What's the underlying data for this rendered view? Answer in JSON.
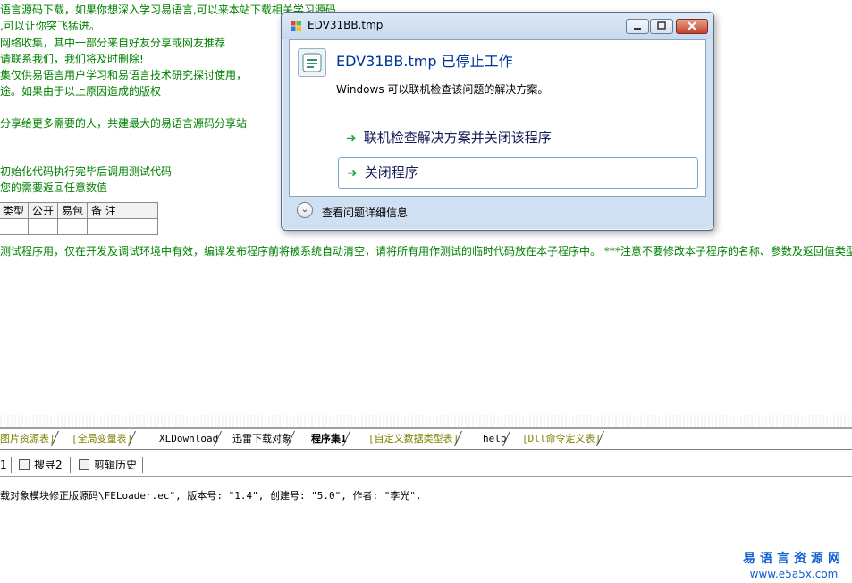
{
  "code_comments": [
    "语言源码下载，如果你想深入学习易语言,可以来本站下载相关学习源码",
    ",可以让你突飞猛进。",
    "网络收集，其中一部分来自好友分享或网友推荐",
    "请联系我们，我们将及时删除!",
    "集仅供易语言用户学习和易语言技术研究探讨使用，",
    "途。如果由于以上原因造成的版权",
    "分享给更多需要的人，共建最大的易语言源码分享站",
    "初始化代码执行完毕后调用测试代码",
    "您的需要返回任意数值"
  ],
  "param_table": {
    "headers": [
      "类型",
      "公开",
      "易包",
      "备 注"
    ]
  },
  "long_comment": "测试程序用，仅在开发及调试环境中有效，编译发布程序前将被系统自动清空，请将所有用作测试的临时代码放在本子程序中。 ***注意不要修改本子程序的名称、参数及返回值类型。",
  "editor_tabs": [
    {
      "label": "图片资源表]"
    },
    {
      "label": "[全局变量表]"
    },
    {
      "label": "XLDownload"
    },
    {
      "label": "迅雷下载对象"
    },
    {
      "label": "程序集1"
    },
    {
      "label": "[自定义数据类型表]"
    },
    {
      "label": "help"
    },
    {
      "label": "[Dll命令定义表]"
    }
  ],
  "output_tabs": {
    "search1": "1",
    "search2": "搜寻2",
    "clipboard": "剪辑历史"
  },
  "output_text": "载对象模块修正版源码\\FELoader.ec\", 版本号: \"1.4\", 创建号: \"5.0\", 作者: \"李光\".",
  "watermark": {
    "cn": "易语言资源网",
    "en": "www.e5a5x.com"
  },
  "dialog": {
    "title": "EDV31BB.tmp",
    "main_instruction": "EDV31BB.tmp 已停止工作",
    "content": "Windows 可以联机检查该问题的解决方案。",
    "command1": "联机检查解决方案并关闭该程序",
    "command2": "关闭程序",
    "details": "查看问题详细信息",
    "arrow_glyph": "➜",
    "expand_glyph": "⌄"
  },
  "colors": {
    "comment": "#008000",
    "tab_inactive": "#808000",
    "dialog_title_blue": "#003399",
    "watermark": "#1060d0"
  }
}
